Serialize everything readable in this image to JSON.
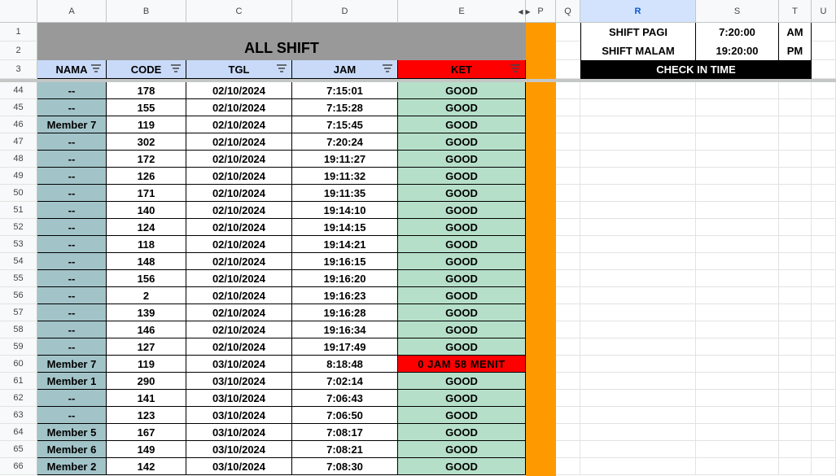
{
  "columns": [
    "A",
    "B",
    "C",
    "D",
    "E",
    "P",
    "Q",
    "R",
    "S",
    "T",
    "U"
  ],
  "title": "ALL SHIFT",
  "headers": {
    "nama": "NAMA",
    "code": "CODE",
    "tgl": "TGL",
    "jam": "JAM",
    "ket": "KET"
  },
  "shift_info": {
    "pagi_label": "SHIFT PAGI",
    "pagi_time": "7:20:00",
    "pagi_ampm": "AM",
    "malam_label": "SHIFT MALAM",
    "malam_time": "19:20:00",
    "malam_ampm": "PM",
    "check_in": "CHECK IN TIME"
  },
  "top_rows": [
    "1",
    "2",
    "3"
  ],
  "rows": [
    {
      "n": "44",
      "nama": "--",
      "code": "178",
      "tgl": "02/10/2024",
      "jam": "7:15:01",
      "ket": "GOOD",
      "bad": false
    },
    {
      "n": "45",
      "nama": "--",
      "code": "155",
      "tgl": "02/10/2024",
      "jam": "7:15:28",
      "ket": "GOOD",
      "bad": false
    },
    {
      "n": "46",
      "nama": "Member 7",
      "code": "119",
      "tgl": "02/10/2024",
      "jam": "7:15:45",
      "ket": "GOOD",
      "bad": false
    },
    {
      "n": "47",
      "nama": "--",
      "code": "302",
      "tgl": "02/10/2024",
      "jam": "7:20:24",
      "ket": "GOOD",
      "bad": false
    },
    {
      "n": "48",
      "nama": "--",
      "code": "172",
      "tgl": "02/10/2024",
      "jam": "19:11:27",
      "ket": "GOOD",
      "bad": false
    },
    {
      "n": "49",
      "nama": "--",
      "code": "126",
      "tgl": "02/10/2024",
      "jam": "19:11:32",
      "ket": "GOOD",
      "bad": false
    },
    {
      "n": "50",
      "nama": "--",
      "code": "171",
      "tgl": "02/10/2024",
      "jam": "19:11:35",
      "ket": "GOOD",
      "bad": false
    },
    {
      "n": "51",
      "nama": "--",
      "code": "140",
      "tgl": "02/10/2024",
      "jam": "19:14:10",
      "ket": "GOOD",
      "bad": false
    },
    {
      "n": "52",
      "nama": "--",
      "code": "124",
      "tgl": "02/10/2024",
      "jam": "19:14:15",
      "ket": "GOOD",
      "bad": false
    },
    {
      "n": "53",
      "nama": "--",
      "code": "118",
      "tgl": "02/10/2024",
      "jam": "19:14:21",
      "ket": "GOOD",
      "bad": false
    },
    {
      "n": "54",
      "nama": "--",
      "code": "148",
      "tgl": "02/10/2024",
      "jam": "19:16:15",
      "ket": "GOOD",
      "bad": false
    },
    {
      "n": "55",
      "nama": "--",
      "code": "156",
      "tgl": "02/10/2024",
      "jam": "19:16:20",
      "ket": "GOOD",
      "bad": false
    },
    {
      "n": "56",
      "nama": "--",
      "code": "2",
      "tgl": "02/10/2024",
      "jam": "19:16:23",
      "ket": "GOOD",
      "bad": false
    },
    {
      "n": "57",
      "nama": "--",
      "code": "139",
      "tgl": "02/10/2024",
      "jam": "19:16:28",
      "ket": "GOOD",
      "bad": false
    },
    {
      "n": "58",
      "nama": "--",
      "code": "146",
      "tgl": "02/10/2024",
      "jam": "19:16:34",
      "ket": "GOOD",
      "bad": false
    },
    {
      "n": "59",
      "nama": "--",
      "code": "127",
      "tgl": "02/10/2024",
      "jam": "19:17:49",
      "ket": "GOOD",
      "bad": false
    },
    {
      "n": "60",
      "nama": "Member 7",
      "code": "119",
      "tgl": "03/10/2024",
      "jam": "8:18:48",
      "ket": "0 JAM 58 MENIT",
      "bad": true
    },
    {
      "n": "61",
      "nama": "Member 1",
      "code": "290",
      "tgl": "03/10/2024",
      "jam": "7:02:14",
      "ket": "GOOD",
      "bad": false
    },
    {
      "n": "62",
      "nama": "--",
      "code": "141",
      "tgl": "03/10/2024",
      "jam": "7:06:43",
      "ket": "GOOD",
      "bad": false
    },
    {
      "n": "63",
      "nama": "--",
      "code": "123",
      "tgl": "03/10/2024",
      "jam": "7:06:50",
      "ket": "GOOD",
      "bad": false
    },
    {
      "n": "64",
      "nama": "Member 5",
      "code": "167",
      "tgl": "03/10/2024",
      "jam": "7:08:17",
      "ket": "GOOD",
      "bad": false
    },
    {
      "n": "65",
      "nama": "Member 6",
      "code": "149",
      "tgl": "03/10/2024",
      "jam": "7:08:21",
      "ket": "GOOD",
      "bad": false
    },
    {
      "n": "66",
      "nama": "Member 2",
      "code": "142",
      "tgl": "03/10/2024",
      "jam": "7:08:30",
      "ket": "GOOD",
      "bad": false
    }
  ],
  "colors": {
    "accent_orange": "#ff9900",
    "name_fill": "#a2c4c9",
    "good_fill": "#b6dfc9",
    "bad_fill": "#ff0000",
    "header_fill": "#c9daf8",
    "title_fill": "#999999"
  }
}
